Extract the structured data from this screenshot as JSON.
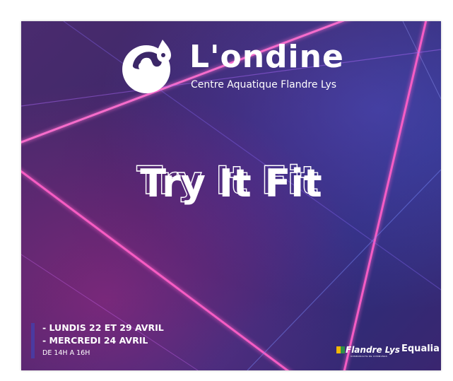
{
  "brand": {
    "name": "L'ondine",
    "subtitle": "Centre Aquatique Flandre Lys"
  },
  "event": {
    "title": "Try It Fit"
  },
  "schedule": {
    "line1": "- LUNDIS 22 ET 29 AVRIL",
    "line2": "- MERCREDI 24 AVRIL",
    "hours": "DE 14H A 16H"
  },
  "partners": {
    "flandre_lys": "Flandre Lys",
    "flandre_lys_sub": "COMMUNAUTE DE COMMUNES",
    "equalia": "Equalia"
  },
  "icons": {
    "logo": "water-drop-swimmer-icon",
    "flandre_lys_mark": "flag-stripes-icon"
  },
  "colors": {
    "background": "#3b2768",
    "neon_pink": "#ff4fc3",
    "neon_purple": "#b06cff",
    "neon_blue": "#7b8cff",
    "accent_bar": "#4a3aa0",
    "text": "#ffffff"
  }
}
